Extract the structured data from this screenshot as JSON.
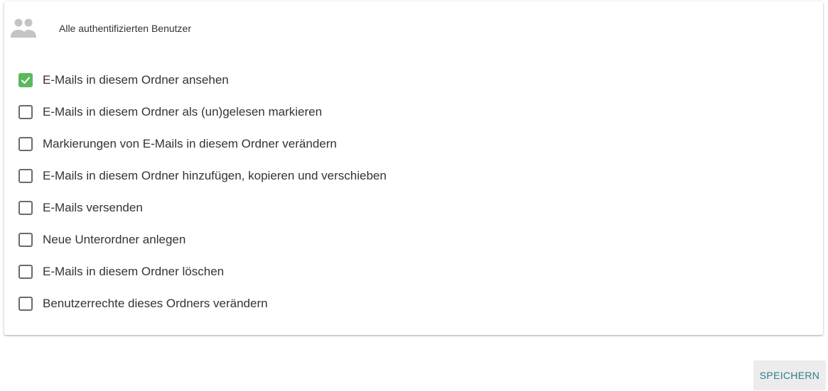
{
  "group": {
    "icon": "people-icon",
    "label": "Alle authentifizierten Benutzer"
  },
  "permissions": [
    {
      "label": "E-Mails in diesem Ordner ansehen",
      "checked": true
    },
    {
      "label": "E-Mails in diesem Ordner als (un)gelesen markieren",
      "checked": false
    },
    {
      "label": "Markierungen von E-Mails in diesem Ordner verändern",
      "checked": false
    },
    {
      "label": "E-Mails in diesem Ordner hinzufügen, kopieren und verschieben",
      "checked": false
    },
    {
      "label": "E-Mails versenden",
      "checked": false
    },
    {
      "label": "Neue Unterordner anlegen",
      "checked": false
    },
    {
      "label": "E-Mails in diesem Ordner löschen",
      "checked": false
    },
    {
      "label": "Benutzerrechte dieses Ordners verändern",
      "checked": false
    }
  ],
  "actions": {
    "save_label": "SPEICHERN"
  },
  "colors": {
    "checked": "#5cb85c",
    "accent_text": "#2e7d8c",
    "icon_gray": "#c4c4c4"
  }
}
